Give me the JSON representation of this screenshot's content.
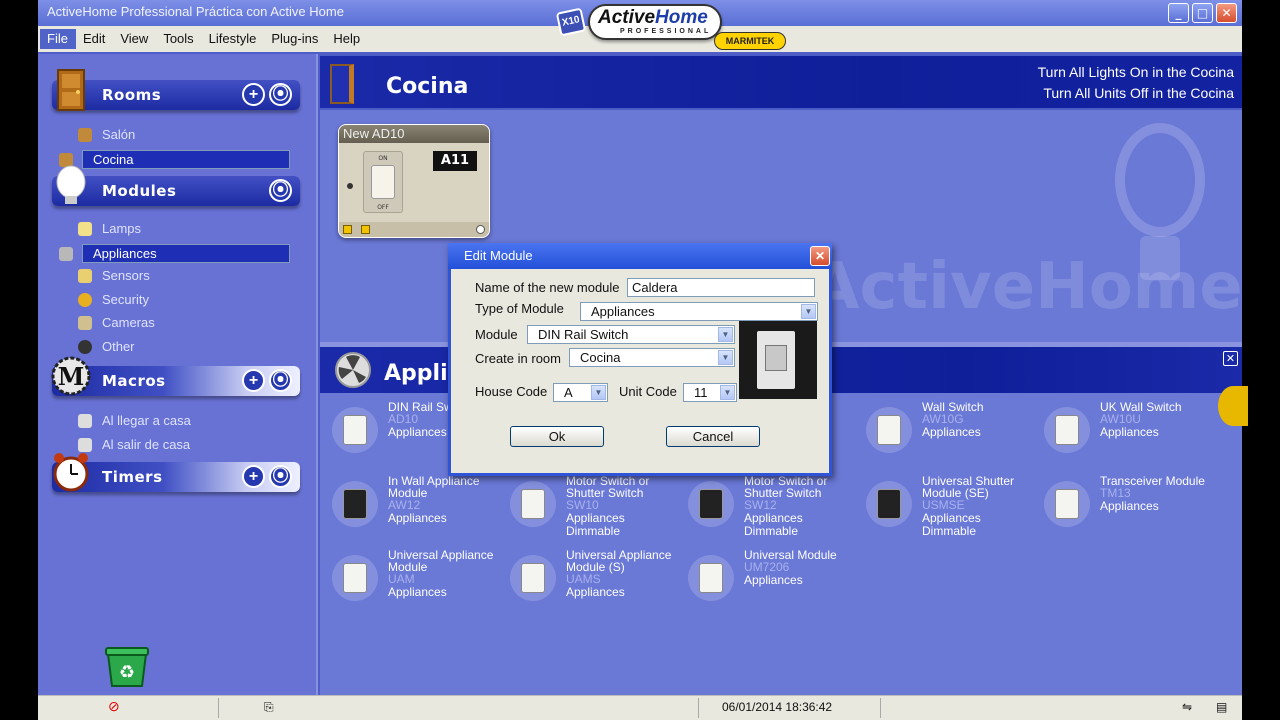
{
  "window": {
    "title": "ActiveHome Professional Práctica con Active Home",
    "logo": {
      "badge": "X10",
      "brand_a": "Active",
      "brand_b": "Home",
      "sub": "PROFESSIONAL",
      "partner": "MARMITEK"
    },
    "controls": {
      "minimize": "_",
      "maximize": "□",
      "close": "✕"
    }
  },
  "menu": [
    "File",
    "Edit",
    "View",
    "Tools",
    "Lifestyle",
    "Plug-ins",
    "Help"
  ],
  "sidebar": {
    "rooms": {
      "label": "Rooms",
      "items": [
        "Salón",
        "Cocina"
      ],
      "selected": "Cocina"
    },
    "modules": {
      "label": "Modules",
      "items": [
        "Lamps",
        "Appliances",
        "Sensors",
        "Security",
        "Cameras",
        "Other"
      ],
      "selected": "Appliances"
    },
    "macros": {
      "label": "Macros",
      "items": [
        "Al llegar a casa",
        "Al salir de casa"
      ]
    },
    "timers": {
      "label": "Timers"
    },
    "btn_add": "+",
    "btn_collapse": "⦿"
  },
  "room": {
    "title": "Cocina",
    "link_lights_on": "Turn All Lights On in the Cocina",
    "link_units_off": "Turn All Units Off in the Cocina",
    "watermark": "ActiveHome",
    "card": {
      "title": "New AD10",
      "code": "A11",
      "on": "ON",
      "off": "OFF"
    }
  },
  "appliances": {
    "title": "Appliances",
    "close": "✕",
    "modules": [
      {
        "name": "DIN Rail Switch",
        "code": "AD10",
        "cls": "Appliances",
        "extra": ""
      },
      {
        "name": "Wall Switch",
        "code": "AW10G",
        "cls": "Appliances",
        "extra": ""
      },
      {
        "name": "UK Wall Switch",
        "code": "AW10U",
        "cls": "Appliances",
        "extra": ""
      },
      {
        "name": "In Wall Appliance Module",
        "code": "AW12",
        "cls": "Appliances",
        "extra": ""
      },
      {
        "name": "Motor Switch or Shutter Switch",
        "code": "SW10",
        "cls": "Appliances",
        "extra": "Dimmable"
      },
      {
        "name": "Motor Switch or Shutter Switch",
        "code": "SW12",
        "cls": "Appliances",
        "extra": "Dimmable"
      },
      {
        "name": "Universal Shutter Module (SE)",
        "code": "USMSE",
        "cls": "Appliances",
        "extra": "Dimmable"
      },
      {
        "name": "Transceiver Module",
        "code": "TM13",
        "cls": "Appliances",
        "extra": ""
      },
      {
        "name": "Universal Appliance Module",
        "code": "UAM",
        "cls": "Appliances",
        "extra": ""
      },
      {
        "name": "Universal Appliance Module (S)",
        "code": "UAMS",
        "cls": "Appliances",
        "extra": ""
      },
      {
        "name": "Universal Module",
        "code": "UM7206",
        "cls": "Appliances",
        "extra": ""
      }
    ]
  },
  "dialog": {
    "title": "Edit Module",
    "name_label": "Name of the new module",
    "name_value": "Caldera",
    "type_label": "Type of Module",
    "type_value": "Appliances",
    "module_label": "Module",
    "module_value": "DIN Rail Switch",
    "room_label": "Create in room",
    "room_value": "Cocina",
    "house_label": "House Code",
    "house_value": "A",
    "unit_label": "Unit Code",
    "unit_value": "11",
    "ok": "Ok",
    "cancel": "Cancel",
    "close": "✕"
  },
  "status": {
    "datetime": "06/01/2014 18:36:42"
  },
  "colors": {
    "accent": "#1e2fb5",
    "panel": "#6a78d6",
    "header": "#0f1f9a"
  }
}
